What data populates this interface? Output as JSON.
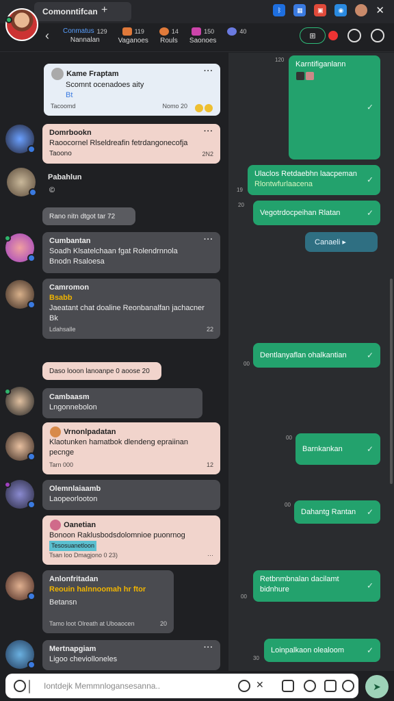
{
  "window": {
    "tab_title": "Comonntifcan",
    "tab_plus": "+",
    "close": "✕"
  },
  "header": {
    "back": "‹",
    "nav": [
      {
        "label": "Nannalan",
        "count": "Conmatus",
        "badge": "129",
        "color": "#3a7ae0"
      },
      {
        "label": "Vaganoes",
        "count": "",
        "badge": "119",
        "color": "#e0793a"
      },
      {
        "label": "Rouls",
        "count": "",
        "badge": "14",
        "color": "#e07a3a"
      },
      {
        "label": "Saonoes",
        "count": "",
        "badge": "150",
        "color": "#cc44aa"
      },
      {
        "label": "",
        "count": "",
        "badge": "40",
        "color": "#6a7ae0"
      }
    ],
    "grid_label": "⊞"
  },
  "left_messages": [
    {
      "name": "Kame Fraptam",
      "line1": "Scomnt ocenadoes aity",
      "line2": "Bt",
      "footer": "Tacoomd",
      "time": "Nomo 20"
    },
    {
      "name": "Domrbookn",
      "line1": "Raoocornel  Rlseldreafin fetrdangonecofja",
      "line2": "Taoono",
      "time": "2N2"
    },
    {
      "name": "Pabahlun",
      "line1": "©"
    },
    {
      "system": "Rano nitn  dtgot tar 72"
    },
    {
      "name": "Cumbantan",
      "line1": "Soadh  Klsatelchaan fgat Rolendrnnola",
      "line2": "Bnodn  Rsaloesa"
    },
    {
      "name": "Camromon",
      "line1": "Bsabb",
      "line2": "Jaeatant chat doaline Reonbanalfan jachacner",
      "line3": "Bk",
      "footer": "Ldahsalle",
      "time": "22"
    },
    {
      "system": "Daso looon  lanoanpe 0 aoose 20"
    },
    {
      "name": "Cambaasm",
      "line1": "Lngonnebolon"
    },
    {
      "name": "Vrnonlpadatan",
      "line1": "Klaotunken hamatbok dlendeng epraiinan",
      "line2": "pecnge",
      "footer": "Tarn 000",
      "time": "12"
    },
    {
      "name": "Olemnlaiaamb",
      "line1": "Laopeorlooton"
    },
    {
      "name": "Oanetian",
      "line1": "Bonoon   Raklusbodsdolomnioe puonrnog",
      "line2": "Tesosuanetloon",
      "footer": "Tsan loo Dmagjono 0 23)"
    },
    {
      "name": "Anlonfritadan",
      "line1": "Reouin  halnnoomah hr  ftor",
      "line2": "Betansn",
      "footer": "Tamo loot Olreath at Uboaocen",
      "time": "20"
    },
    {
      "name": "Mertnapgiam",
      "line1": "Ligoo cheviolloneles"
    }
  ],
  "right_messages": [
    {
      "text": "Karntifiganlann",
      "time": "120"
    },
    {
      "text": "Ulaclos  Retdaebhn laacpeman",
      "text2": "Rlontwfurlaacena",
      "time": "19"
    },
    {
      "text": "Vegotrdocpeihan Rlatan",
      "time": "20"
    },
    {
      "text": "Canaeli",
      "time": ""
    },
    {
      "text": "Dentlanyaflan ohalkantian",
      "time": "00"
    },
    {
      "text": "Barnkankan",
      "time": "00"
    },
    {
      "text": "Dahantg Rantan",
      "time": "00"
    },
    {
      "text": "Retbnmbnalan dacilamt",
      "text2": "bidnhure",
      "time": "00"
    },
    {
      "text": "Loinpalkaon olealoom",
      "time": "30"
    }
  ],
  "input": {
    "placeholder": "Iontdejk Memmnlogansesanna.."
  },
  "colors": {
    "accent_green": "#23a26d",
    "bg": "#1f2023"
  }
}
